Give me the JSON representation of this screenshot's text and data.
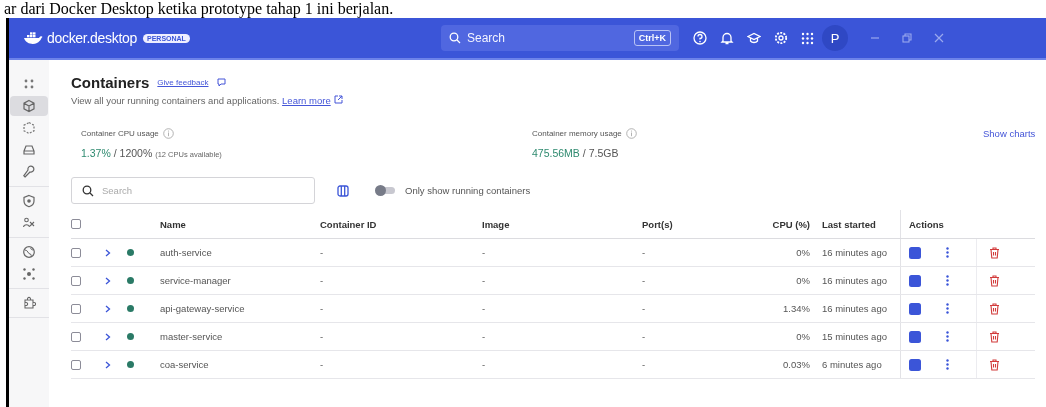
{
  "caption": "ar dari Docker Desktop ketika prototype tahap 1 ini berjalan.",
  "titlebar": {
    "logo_text": "docker.desktop",
    "plan_badge": "PERSONAL",
    "search_placeholder": "Search",
    "shortcut": "Ctrl+K",
    "avatar": "P"
  },
  "sidebar": {
    "groups": [
      {
        "items": [
          {
            "selected": false
          },
          {
            "selected": true
          },
          {
            "selected": false
          },
          {
            "selected": false
          },
          {
            "selected": false
          }
        ]
      },
      {
        "items": [
          {
            "selected": false
          },
          {
            "selected": false
          }
        ]
      },
      {
        "items": [
          {
            "selected": false
          },
          {
            "selected": false
          }
        ]
      },
      {
        "items": [
          {
            "selected": false
          }
        ]
      }
    ]
  },
  "page": {
    "title": "Containers",
    "feedback_link": "Give feedback",
    "subtitle": "View all your running containers and applications.",
    "learn_more_link": "Learn more"
  },
  "stats": {
    "cpu_label": "Container CPU usage",
    "cpu_value": "1.37%",
    "cpu_limit": "/ 1200%",
    "cpu_note": "(12 CPUs available)",
    "memory_label": "Container memory usage",
    "memory_value": "475.56MB",
    "memory_limit": "/ 7.5GB",
    "show_charts_link": "Show charts"
  },
  "toolbar": {
    "search_placeholder": "Search",
    "only_running": false,
    "only_running_label": "Only show running containers"
  },
  "table": {
    "all_checked": false,
    "columns": [
      "Name",
      "Container ID",
      "Image",
      "Port(s)",
      "CPU (%)",
      "Last started",
      "Actions"
    ],
    "rows": [
      {
        "checked": false,
        "running": true,
        "name": "auth-service",
        "container_id": "-",
        "image": "-",
        "ports": "-",
        "cpu": "0%",
        "last_started": "16 minutes ago"
      },
      {
        "checked": false,
        "running": true,
        "name": "service-manager",
        "container_id": "-",
        "image": "-",
        "ports": "-",
        "cpu": "0%",
        "last_started": "16 minutes ago"
      },
      {
        "checked": false,
        "running": true,
        "name": "api-gateway-service",
        "container_id": "-",
        "image": "-",
        "ports": "-",
        "cpu": "1.34%",
        "last_started": "16 minutes ago"
      },
      {
        "checked": false,
        "running": true,
        "name": "master-service",
        "container_id": "-",
        "image": "-",
        "ports": "-",
        "cpu": "0%",
        "last_started": "15 minutes ago"
      },
      {
        "checked": false,
        "running": true,
        "name": "coa-service",
        "container_id": "-",
        "image": "-",
        "ports": "-",
        "cpu": "0.03%",
        "last_started": "6 minutes ago"
      }
    ]
  }
}
